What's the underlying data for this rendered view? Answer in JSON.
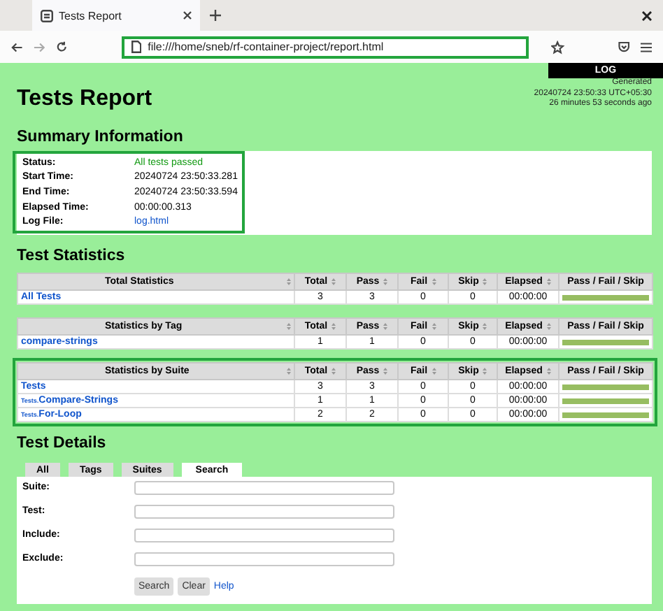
{
  "browser": {
    "tab": {
      "title": "Tests Report",
      "selected": true
    },
    "address": {
      "value": "file:///home/sneb/rf-container-project/report.html",
      "highlighted": true
    }
  },
  "log_button": "LOG",
  "title": "Tests Report",
  "generated": [
    "Generated",
    "20240724 23:50:33 UTC+05:30",
    "26 minutes 53 seconds ago"
  ],
  "summary": {
    "heading": "Summary Information",
    "highlighted": true,
    "rows": [
      {
        "label": "Status:",
        "value": "All tests passed",
        "kind": "status"
      },
      {
        "label": "Start Time:",
        "value": "20240724 23:50:33.281",
        "kind": "text"
      },
      {
        "label": "End Time:",
        "value": "20240724 23:50:33.594",
        "kind": "text"
      },
      {
        "label": "Elapsed Time:",
        "value": "00:00:00.313",
        "kind": "text"
      },
      {
        "label": "Log File:",
        "value": "log.html",
        "kind": "link"
      }
    ]
  },
  "statistics": {
    "heading": "Test Statistics",
    "tables": [
      {
        "highlighted": false,
        "columns": [
          {
            "label": "Total Statistics",
            "sortable": true
          },
          {
            "label": "Total",
            "sortable": true
          },
          {
            "label": "Pass",
            "sortable": true
          },
          {
            "label": "Fail",
            "sortable": true
          },
          {
            "label": "Skip",
            "sortable": true
          },
          {
            "label": "Elapsed",
            "sortable": true
          },
          {
            "label": "Pass / Fail / Skip",
            "sortable": false
          }
        ],
        "rows": [
          {
            "name": "All Tests",
            "total": "3",
            "pass": "3",
            "fail": "0",
            "skip": "0",
            "elapsed": "00:00:00",
            "level": 1
          }
        ]
      },
      {
        "highlighted": false,
        "columns": [
          {
            "label": "Statistics by Tag",
            "sortable": true
          },
          {
            "label": "Total",
            "sortable": true
          },
          {
            "label": "Pass",
            "sortable": true
          },
          {
            "label": "Fail",
            "sortable": true
          },
          {
            "label": "Skip",
            "sortable": true
          },
          {
            "label": "Elapsed",
            "sortable": true
          },
          {
            "label": "Pass / Fail / Skip",
            "sortable": false
          }
        ],
        "rows": [
          {
            "name": "compare-strings",
            "total": "1",
            "pass": "1",
            "fail": "0",
            "skip": "0",
            "elapsed": "00:00:00",
            "level": 1
          }
        ]
      },
      {
        "highlighted": true,
        "columns": [
          {
            "label": "Statistics by Suite",
            "sortable": true
          },
          {
            "label": "Total",
            "sortable": true
          },
          {
            "label": "Pass",
            "sortable": true
          },
          {
            "label": "Fail",
            "sortable": true
          },
          {
            "label": "Skip",
            "sortable": true
          },
          {
            "label": "Elapsed",
            "sortable": true
          },
          {
            "label": "Pass / Fail / Skip",
            "sortable": false
          }
        ],
        "rows": [
          {
            "name": "Tests",
            "total": "3",
            "pass": "3",
            "fail": "0",
            "skip": "0",
            "elapsed": "00:00:00",
            "level": 1
          },
          {
            "parent": "Tests.",
            "name": "Compare-Strings",
            "total": "1",
            "pass": "1",
            "fail": "0",
            "skip": "0",
            "elapsed": "00:00:00",
            "level": 1
          },
          {
            "parent": "Tests.",
            "name": "For-Loop",
            "total": "2",
            "pass": "2",
            "fail": "0",
            "skip": "0",
            "elapsed": "00:00:00",
            "level": 1
          }
        ]
      }
    ]
  },
  "details": {
    "heading": "Test Details",
    "tabs": [
      {
        "label": "All",
        "selected": false
      },
      {
        "label": "Tags",
        "selected": false
      },
      {
        "label": "Suites",
        "selected": false
      },
      {
        "label": "Search",
        "selected": true
      }
    ],
    "fields": [
      {
        "label": "Suite:"
      },
      {
        "label": "Test:"
      },
      {
        "label": "Include:"
      },
      {
        "label": "Exclude:"
      }
    ],
    "buttons": [
      "Search",
      "Clear"
    ],
    "help": "Help"
  }
}
